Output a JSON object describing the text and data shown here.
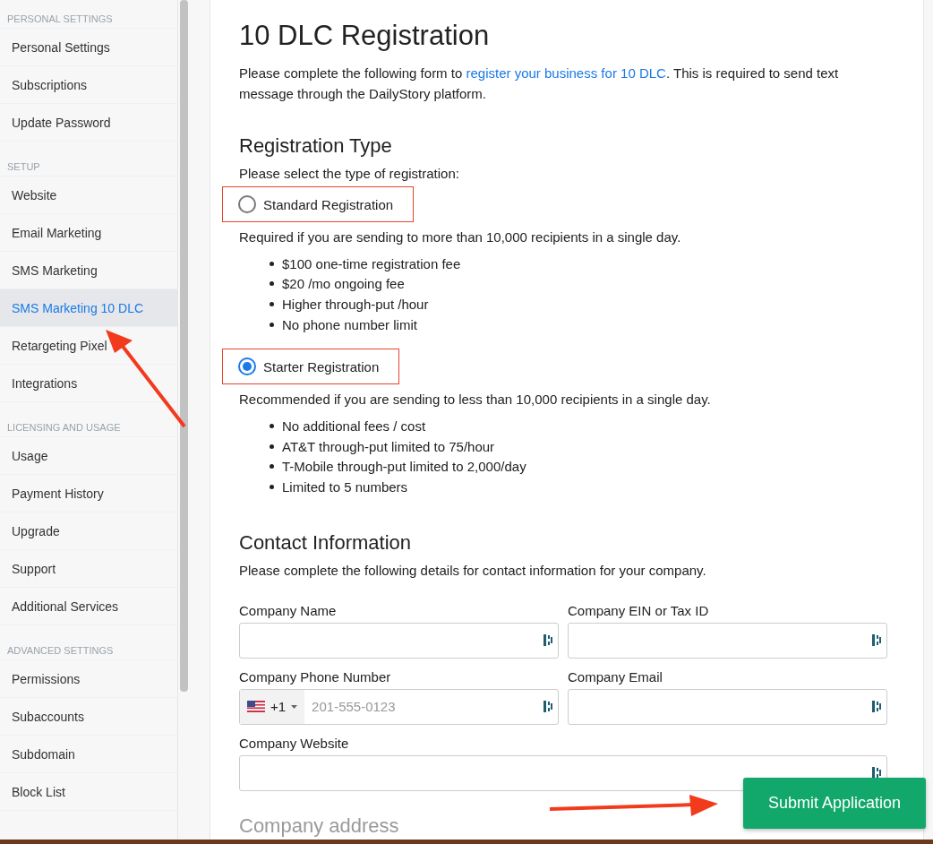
{
  "sidebar": {
    "sections": [
      {
        "heading": "PERSONAL SETTINGS",
        "items": [
          {
            "label": "Personal Settings",
            "selected": false
          },
          {
            "label": "Subscriptions",
            "selected": false
          },
          {
            "label": "Update Password",
            "selected": false
          }
        ]
      },
      {
        "heading": "SETUP",
        "items": [
          {
            "label": "Website",
            "selected": false
          },
          {
            "label": "Email Marketing",
            "selected": false
          },
          {
            "label": "SMS Marketing",
            "selected": false
          },
          {
            "label": "SMS Marketing 10 DLC",
            "selected": true
          },
          {
            "label": "Retargeting Pixel",
            "selected": false
          },
          {
            "label": "Integrations",
            "selected": false
          }
        ]
      },
      {
        "heading": "LICENSING AND USAGE",
        "items": [
          {
            "label": "Usage",
            "selected": false
          },
          {
            "label": "Payment History",
            "selected": false
          },
          {
            "label": "Upgrade",
            "selected": false
          },
          {
            "label": "Support",
            "selected": false
          },
          {
            "label": "Additional Services",
            "selected": false
          }
        ]
      },
      {
        "heading": "ADVANCED SETTINGS",
        "items": [
          {
            "label": "Permissions",
            "selected": false
          },
          {
            "label": "Subaccounts",
            "selected": false
          },
          {
            "label": "Subdomain",
            "selected": false
          },
          {
            "label": "Block List",
            "selected": false
          }
        ]
      }
    ]
  },
  "page": {
    "title": "10 DLC Registration",
    "intro": {
      "before": "Please complete the following form to ",
      "link": "register your business for 10 DLC",
      "after": ". This is required to send text message through the DailyStory platform."
    }
  },
  "registration_type": {
    "heading": "Registration Type",
    "prompt": "Please select the type of registration:",
    "options": [
      {
        "label": "Standard Registration",
        "selected": false,
        "description": "Required if you are sending to more than 10,000 recipients in a single day.",
        "bullets": [
          "$100 one-time registration fee",
          "$20 /mo ongoing fee",
          "Higher through-put /hour",
          "No phone number limit"
        ]
      },
      {
        "label": "Starter Registration",
        "selected": true,
        "description": "Recommended if you are sending to less than 10,000 recipients in a single day.",
        "bullets": [
          "No additional fees / cost",
          "AT&T through-put limited to 75/hour",
          "T-Mobile through-put limited to 2,000/day",
          "Limited to 5 numbers"
        ]
      }
    ]
  },
  "contact": {
    "heading": "Contact Information",
    "prompt": "Please complete the following details for contact information for your company.",
    "fields": [
      {
        "label": "Company Name",
        "kind": "text"
      },
      {
        "label": "Company EIN or Tax ID",
        "kind": "text"
      },
      {
        "label": "Company Phone Number",
        "kind": "phone",
        "country_code": "+1",
        "placeholder": "201-555-0123"
      },
      {
        "label": "Company Email",
        "kind": "text"
      },
      {
        "label": "Company Website",
        "kind": "wide"
      }
    ]
  },
  "next_heading": "Company address",
  "submit_button": "Submit Application"
}
